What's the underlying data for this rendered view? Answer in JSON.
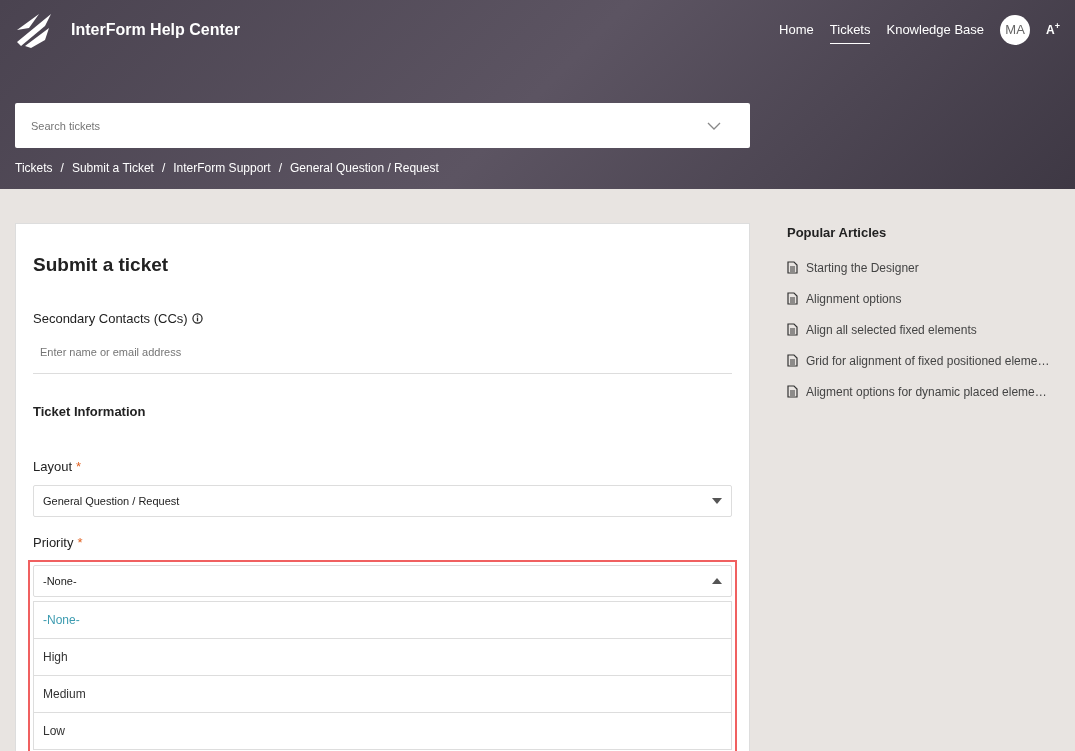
{
  "header": {
    "brand": "InterForm Help Center",
    "nav": [
      {
        "label": "Home",
        "selected": false
      },
      {
        "label": "Tickets",
        "selected": true
      },
      {
        "label": "Knowledge Base",
        "selected": false
      }
    ],
    "avatar": "MA",
    "text_size_button": "A$^{+}$"
  },
  "search": {
    "placeholder": "Search tickets"
  },
  "breadcrumbs": {
    "separator": "/",
    "items": [
      "Tickets",
      "Submit a Ticket",
      "InterForm Support",
      "General Question / Request"
    ]
  },
  "form": {
    "title": "Submit a ticket",
    "cc_label": "Secondary Contacts (CCs)",
    "cc_placeholder": "Enter name or email address",
    "section_title": "Ticket Information",
    "layout": {
      "label": "Layout",
      "required_mark": "*",
      "value": "General Question / Request",
      "expanded": false
    },
    "priority": {
      "label": "Priority",
      "required_mark": "*",
      "value": "-None-",
      "expanded": true,
      "highlighted": true,
      "options": [
        {
          "label": "-None-",
          "selected": true
        },
        {
          "label": "High",
          "selected": false
        },
        {
          "label": "Medium",
          "selected": false
        },
        {
          "label": "Low",
          "selected": false
        }
      ]
    }
  },
  "sidebar": {
    "title": "Popular Articles",
    "articles": [
      "Starting the Designer",
      "Alignment options",
      "Align all selected fixed elements",
      "Grid for alignment of fixed positioned eleme…",
      "Aligment options for dynamic placed eleme…"
    ]
  }
}
